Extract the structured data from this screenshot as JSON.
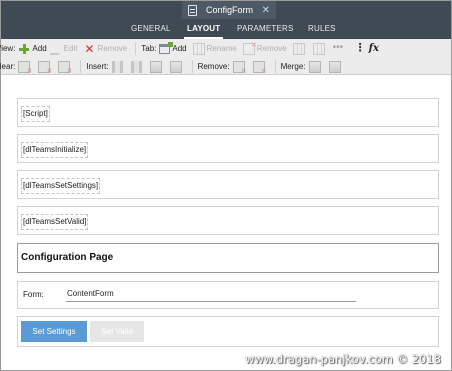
{
  "window": {
    "doc_title": "ConfigForm",
    "close_glyph": "✕"
  },
  "nav": {
    "tabs": [
      {
        "label": "GENERAL",
        "active": false
      },
      {
        "label": "LAYOUT",
        "active": true
      },
      {
        "label": "PARAMETERS",
        "active": false
      },
      {
        "label": "RULES",
        "active": false
      }
    ]
  },
  "ribbon": {
    "row1": {
      "view_label": "View:",
      "add_label": "Add",
      "edit_label": "Edit",
      "remove_label": "Remove",
      "tab_label": "Tab:",
      "tab_add_label": "Add",
      "tab_rename_label": "Rename",
      "tab_remove_label": "Remove",
      "more_glyph": "•••",
      "menu_glyph": "⋮",
      "fx_label": "fx"
    },
    "row2": {
      "clear_label": "Clear:",
      "insert_label": "Insert:",
      "remove_label": "Remove:",
      "merge_label": "Merge:"
    }
  },
  "canvas": {
    "controls": {
      "script": "[Script]",
      "initialize": "[dlTeamsInitialize]",
      "set_settings": "[dlTeamsSetSettings]",
      "set_valid": "[dlTeamsSetValid]"
    },
    "heading": "Configuration Page",
    "form": {
      "label": "Form:",
      "value": "ContentForm"
    },
    "buttons": {
      "set_settings": "Set Settings",
      "set_valid": "Set Valid"
    }
  },
  "watermark": "www.dragan-panjkov.com © 2018",
  "colors": {
    "header_bg": "#3f4a55",
    "ribbon_bg": "#ececec",
    "primary_button": "#5b9bd5",
    "add_green": "#6aa631",
    "remove_red": "#cc3333"
  }
}
